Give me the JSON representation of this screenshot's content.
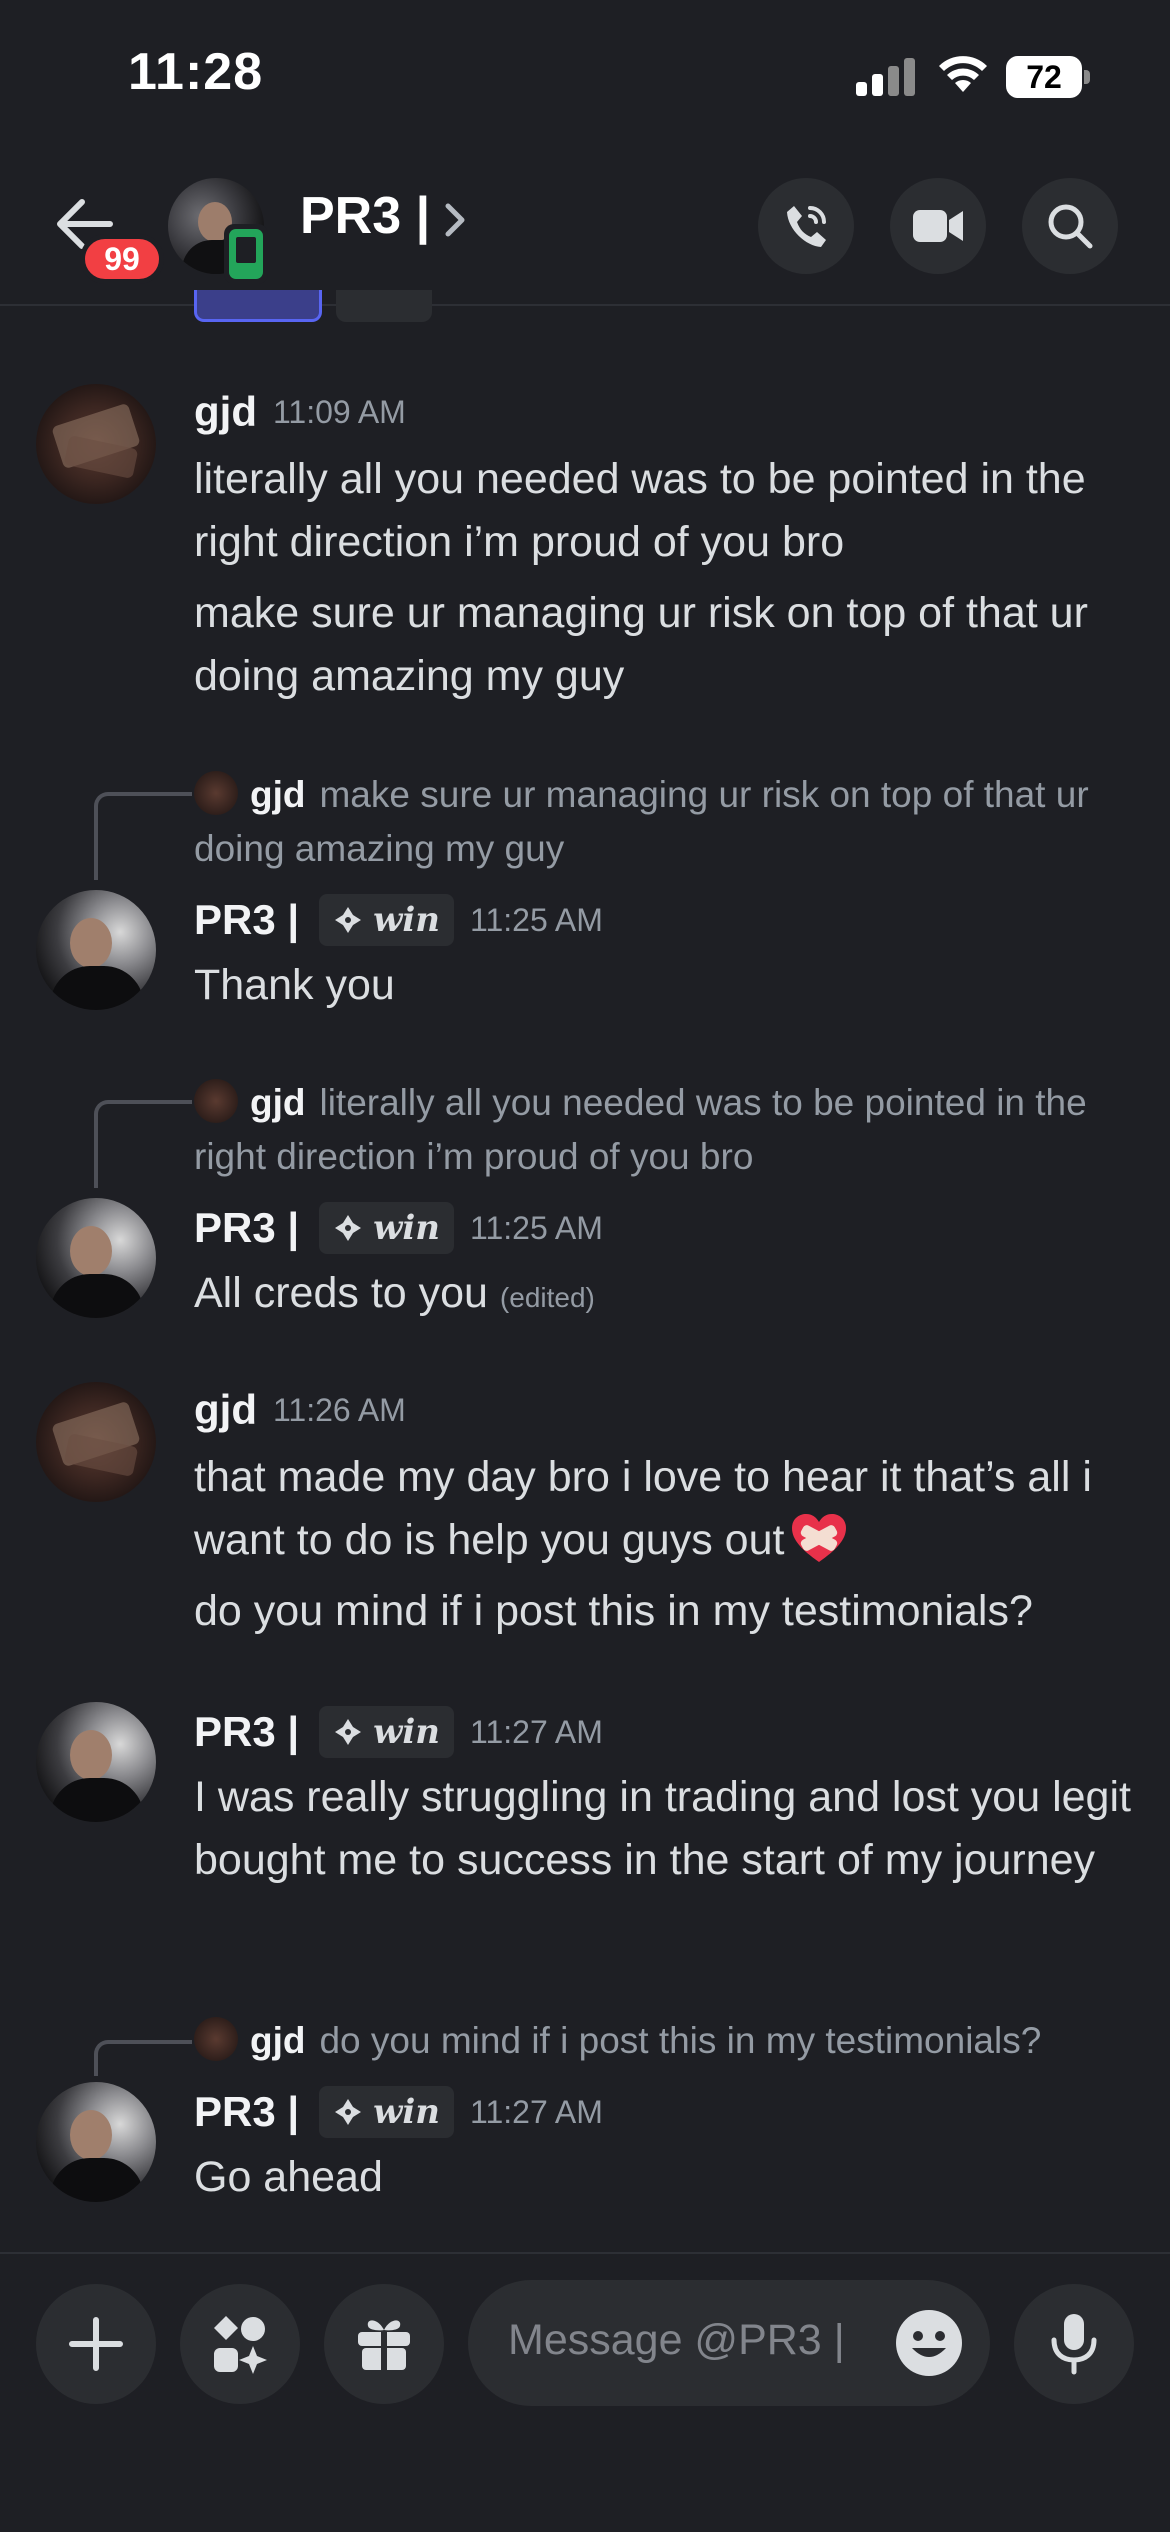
{
  "status_bar": {
    "time": "11:28",
    "battery": "72"
  },
  "header": {
    "back_badge": "99",
    "title": "PR3 |"
  },
  "messages": [
    {
      "author": "gjd",
      "time": "11:09 AM",
      "lines": [
        "literally all you needed was to be pointed in the right direction i’m proud of you bro",
        "make sure ur managing ur risk on top of that ur doing amazing my guy"
      ]
    },
    {
      "reply_author": "gjd",
      "reply_text": "make sure ur managing ur risk on top of that ur doing amazing my guy",
      "author": "PR3 |",
      "tag": "win",
      "time": "11:25 AM",
      "text": "Thank you"
    },
    {
      "reply_author": "gjd",
      "reply_text": "literally all you needed was to be pointed in the right direction i’m proud of you bro",
      "author": "PR3 |",
      "tag": "win",
      "time": "11:25 AM",
      "text": "All creds to you",
      "edited": "(edited)"
    },
    {
      "author": "gjd",
      "time": "11:26 AM",
      "lines": [
        "that made my day bro i love to hear it that’s all i want to do is help you guys out",
        "do you mind if i post this in my testimonials?"
      ]
    },
    {
      "author": "PR3 |",
      "tag": "win",
      "time": "11:27 AM",
      "text": "I was really struggling in trading and lost you legit bought me to success in the start of my journey"
    },
    {
      "reply_author": "gjd",
      "reply_text": "do you mind if i post this in my testimonials?",
      "author": "PR3 |",
      "tag": "win",
      "time": "11:27 AM",
      "text": "Go ahead"
    }
  ],
  "composer": {
    "placeholder": "Message @PR3 |"
  },
  "colors": {
    "background": "#1e1f24",
    "badge": "#f23f43",
    "online_mobile": "#23a55a",
    "text": "#dbdee1",
    "muted": "#949ba4"
  }
}
